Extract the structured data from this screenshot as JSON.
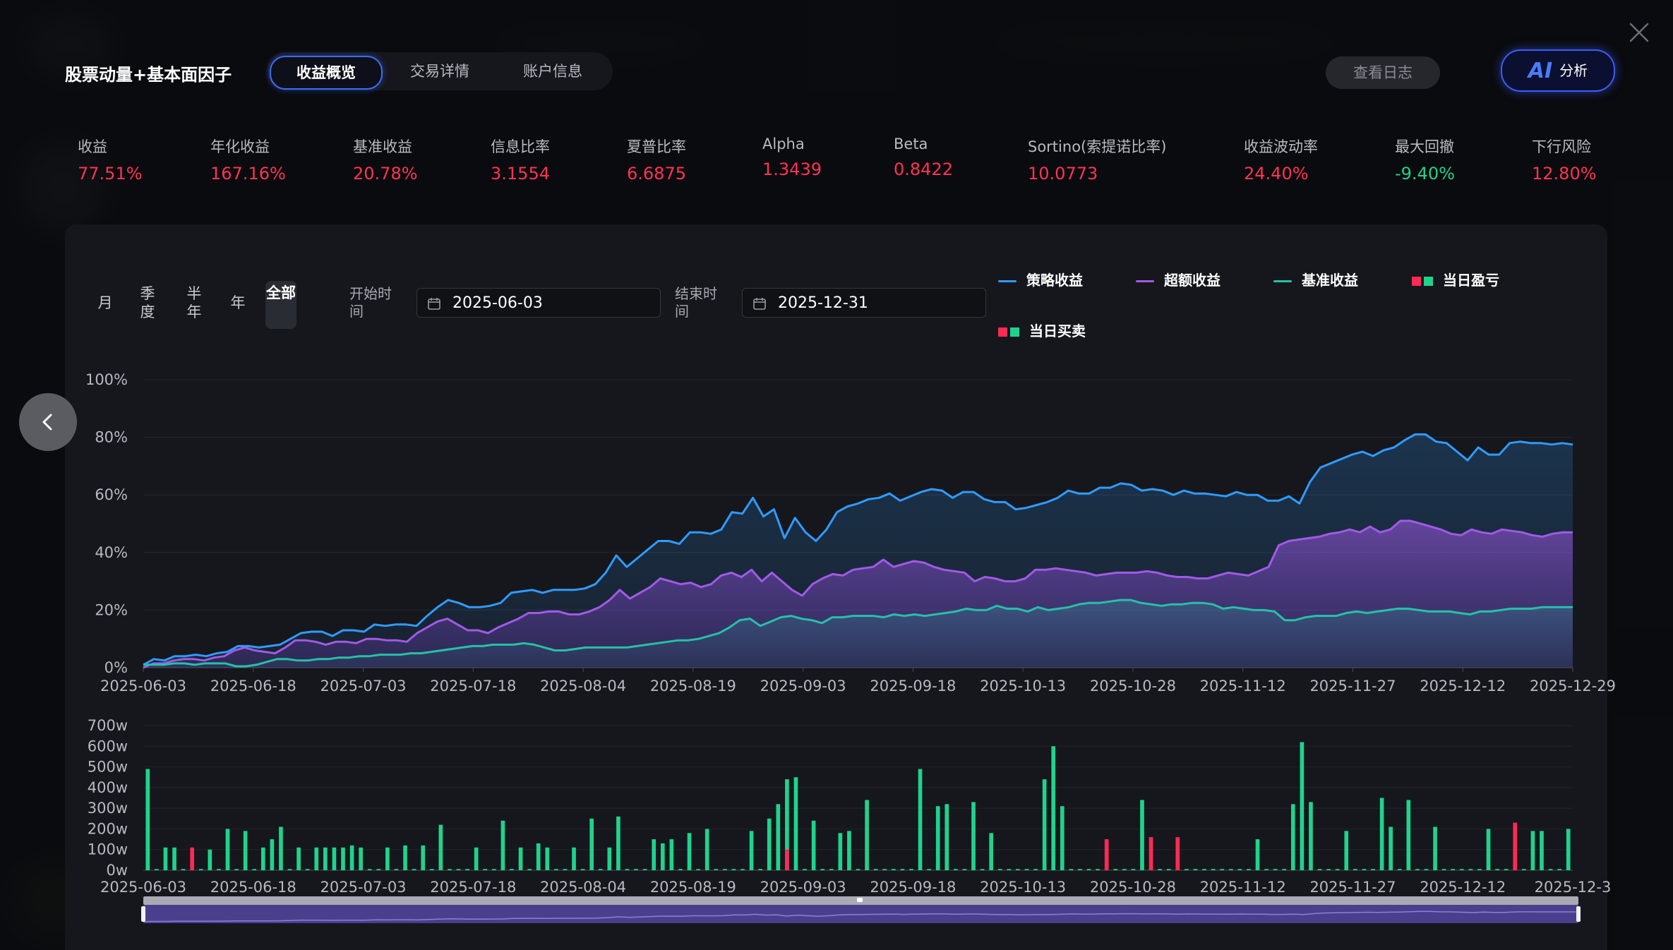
{
  "header": {
    "strategy_name": "股票动量+基本面因子",
    "tabs": [
      {
        "label": "收益概览",
        "active": true
      },
      {
        "label": "交易详情",
        "active": false
      },
      {
        "label": "账户信息",
        "active": false
      }
    ],
    "log_button": "查看日志",
    "ai_button_mark": "AI",
    "ai_button_label": "分析"
  },
  "metrics": [
    {
      "label": "收益",
      "value": "77.51%",
      "tone": "red"
    },
    {
      "label": "年化收益",
      "value": "167.16%",
      "tone": "red"
    },
    {
      "label": "基准收益",
      "value": "20.78%",
      "tone": "red"
    },
    {
      "label": "信息比率",
      "value": "3.1554",
      "tone": "red"
    },
    {
      "label": "夏普比率",
      "value": "6.6875",
      "tone": "red"
    },
    {
      "label": "Alpha",
      "value": "1.3439",
      "tone": "red"
    },
    {
      "label": "Beta",
      "value": "0.8422",
      "tone": "red"
    },
    {
      "label": "Sortino(索提诺比率)",
      "value": "10.0773",
      "tone": "red"
    },
    {
      "label": "收益波动率",
      "value": "24.40%",
      "tone": "red"
    },
    {
      "label": "最大回撤",
      "value": "-9.40%",
      "tone": "green"
    },
    {
      "label": "下行风险",
      "value": "12.80%",
      "tone": "red"
    }
  ],
  "controls": {
    "periods": [
      {
        "label": "月",
        "active": false
      },
      {
        "label": "季度",
        "active": false
      },
      {
        "label": "半年",
        "active": false
      },
      {
        "label": "年",
        "active": false
      },
      {
        "label": "全部",
        "active": true
      }
    ],
    "start_label": "开始时间",
    "start_value": "2025-06-03",
    "end_label": "结束时间",
    "end_value": "2025-12-31"
  },
  "legend": [
    {
      "label": "策略收益",
      "kind": "line",
      "color": "#2f9bff"
    },
    {
      "label": "超额收益",
      "kind": "line",
      "color": "#a259e8"
    },
    {
      "label": "基准收益",
      "kind": "line",
      "color": "#25c1a8"
    },
    {
      "label": "当日盈亏",
      "kind": "squares",
      "colors": [
        "#ff2a55",
        "#1fd38d"
      ]
    },
    {
      "label": "当日买卖",
      "kind": "squares",
      "colors": [
        "#ff2a55",
        "#1fd38d"
      ]
    }
  ],
  "colors": {
    "strategy": "#2f9bff",
    "excess": "#a259e8",
    "benchmark": "#25c1a8",
    "loss": "#ff2a55",
    "gain": "#1fd38d",
    "accent": "#3d6cff"
  },
  "chart_data": {
    "type": "line",
    "x_tick_labels": [
      "2025-06-03",
      "2025-06-18",
      "2025-07-03",
      "2025-07-18",
      "2025-08-04",
      "2025-08-19",
      "2025-09-03",
      "2025-09-18",
      "2025-10-13",
      "2025-10-28",
      "2025-11-12",
      "2025-11-27",
      "2025-12-12",
      "2025-12-29"
    ],
    "y_ticks": [
      "0%",
      "20%",
      "40%",
      "60%",
      "80%",
      "100%"
    ],
    "ylim": [
      0,
      100
    ],
    "grid": true,
    "legend_position": "top-right",
    "series": [
      {
        "name": "策略收益",
        "values": [
          1,
          3,
          2.5,
          4,
          4,
          4.5,
          4,
          5,
          5.5,
          7.5,
          7.5,
          7,
          7.5,
          8,
          10,
          12,
          12.5,
          12.5,
          11,
          13,
          13,
          12.5,
          15,
          14.5,
          15,
          15,
          14.5,
          18,
          21,
          23.5,
          22.5,
          21,
          21,
          21.5,
          22.5,
          26,
          26.5,
          27,
          26,
          27,
          27,
          27,
          27.5,
          29,
          33,
          39,
          35,
          38,
          41,
          44,
          44,
          43,
          47,
          47,
          46.5,
          48,
          54,
          53.5,
          59,
          52.5,
          55,
          45,
          52,
          47,
          44,
          48,
          54,
          56,
          57,
          58.5,
          59,
          60.5,
          58,
          59.5,
          61,
          62,
          61.5,
          59,
          61,
          61,
          58.5,
          57.5,
          57.5,
          55,
          55.5,
          56.5,
          57.5,
          59,
          61.5,
          60.5,
          60.5,
          62.5,
          62.5,
          64,
          63.5,
          61.5,
          62,
          61.5,
          60,
          61.5,
          60.5,
          60.5,
          60,
          59.5,
          61,
          60,
          60,
          58,
          58,
          59.5,
          57,
          64.5,
          69.5,
          71,
          72.5,
          74,
          75,
          73.5,
          75.5,
          76.5,
          79,
          81,
          81,
          78.5,
          78,
          75,
          72,
          76.5,
          74,
          74,
          78,
          78.5,
          78,
          78,
          77.5,
          78,
          77.5
        ],
        "color": "#2f9bff"
      },
      {
        "name": "超额收益",
        "values": [
          0,
          1.5,
          1.5,
          2.5,
          3,
          3,
          2.5,
          3.5,
          4,
          6,
          7,
          6,
          5.5,
          5,
          7,
          9.5,
          9.5,
          9,
          8,
          9,
          9,
          8.5,
          10,
          10,
          9.5,
          9.5,
          9,
          12,
          14,
          16,
          17,
          15,
          13,
          13,
          12,
          14,
          15.5,
          17,
          19,
          19,
          19.5,
          19.5,
          18.5,
          18.5,
          19.5,
          21,
          23.5,
          27,
          24,
          26,
          28,
          31,
          30,
          29,
          29.5,
          28,
          29,
          32,
          33,
          31.5,
          34,
          30,
          33,
          30,
          27,
          25,
          29,
          31,
          32.5,
          32,
          34,
          34.5,
          35,
          37.5,
          35,
          36,
          37,
          36.5,
          35,
          34,
          33.5,
          33,
          30,
          31.5,
          31,
          30,
          30,
          31,
          34,
          34,
          34.5,
          34,
          33.5,
          33,
          32,
          32.5,
          33,
          33,
          33,
          33.5,
          33,
          32,
          31.5,
          31.5,
          31,
          31,
          32,
          33,
          32.5,
          32,
          33.5,
          35,
          42.5,
          44,
          44.5,
          45,
          45.5,
          46.5,
          47,
          48,
          47,
          49,
          47,
          48,
          51,
          51,
          50,
          49,
          48,
          46.5,
          46,
          48,
          47,
          46.5,
          48,
          47.5,
          47,
          46,
          45.5,
          46.5,
          47,
          47
        ],
        "color": "#a259e8"
      },
      {
        "name": "基准收益",
        "values": [
          1,
          1,
          1,
          1.5,
          1.5,
          1,
          1.5,
          1.5,
          1.5,
          0.5,
          0.5,
          1,
          2,
          3,
          3,
          2.5,
          2.5,
          3,
          3,
          3.5,
          3.5,
          4,
          4,
          4.5,
          4.5,
          4.5,
          5,
          5,
          5.5,
          6,
          6.5,
          7,
          7.5,
          7.5,
          8,
          8,
          8,
          8.5,
          8,
          7,
          6,
          6,
          6.5,
          7,
          7,
          7,
          7,
          7,
          7.5,
          8,
          8.5,
          9,
          9.5,
          9.5,
          10,
          11,
          12,
          14,
          16.5,
          17,
          14.5,
          16,
          17.5,
          18,
          17,
          16.5,
          15.5,
          17.5,
          17.5,
          18,
          18,
          18,
          17.5,
          18.5,
          18,
          18.5,
          18,
          18.5,
          19,
          19.5,
          20.5,
          20,
          20,
          21.5,
          20.5,
          20.5,
          19.5,
          21,
          20,
          20.5,
          21,
          22,
          22.5,
          22.5,
          23,
          23.5,
          23.5,
          22.5,
          22,
          21.5,
          22,
          22,
          22.5,
          22.5,
          22,
          20.5,
          21,
          20.5,
          20,
          20,
          19.5,
          16.5,
          16.5,
          17.5,
          18,
          18,
          18,
          19,
          19.5,
          19,
          19.5,
          20,
          20.5,
          20.5,
          20,
          19.5,
          19.5,
          19.5,
          19,
          18.5,
          19.5,
          19.5,
          20,
          20.5,
          20.5,
          20.5,
          21,
          21,
          21,
          21
        ],
        "color": "#25c1a8"
      }
    ],
    "volume": {
      "y_ticks": [
        "0w",
        "100w",
        "200w",
        "300w",
        "400w",
        "500w",
        "600w",
        "700w"
      ],
      "x_tick_labels": [
        "2025-06-03",
        "2025-06-18",
        "2025-07-03",
        "2025-07-18",
        "2025-08-04",
        "2025-08-19",
        "2025-09-03",
        "2025-09-18",
        "2025-10-13",
        "2025-10-28",
        "2025-11-12",
        "2025-11-27",
        "2025-12-12",
        "2025-12-3"
      ],
      "buy_values": [
        490,
        0,
        110,
        110,
        0,
        0,
        0,
        100,
        0,
        200,
        0,
        190,
        0,
        110,
        150,
        210,
        0,
        110,
        0,
        110,
        110,
        110,
        110,
        120,
        110,
        0,
        0,
        110,
        0,
        120,
        0,
        120,
        0,
        220,
        0,
        0,
        0,
        110,
        0,
        0,
        240,
        0,
        110,
        0,
        130,
        110,
        0,
        0,
        110,
        0,
        250,
        0,
        110,
        260,
        0,
        0,
        0,
        150,
        130,
        150,
        0,
        180,
        0,
        200,
        0,
        0,
        0,
        0,
        190,
        0,
        250,
        320,
        440,
        450,
        0,
        240,
        0,
        0,
        180,
        190,
        0,
        340,
        0,
        0,
        0,
        0,
        0,
        490,
        0,
        310,
        320,
        0,
        0,
        330,
        0,
        180,
        0,
        0,
        0,
        0,
        0,
        440,
        600,
        310,
        0,
        0,
        0,
        0,
        0,
        0,
        0,
        0,
        340,
        0,
        0,
        0,
        0,
        0,
        0,
        0,
        0,
        0,
        0,
        0,
        0,
        150,
        0,
        0,
        0,
        320,
        620,
        330,
        0,
        0,
        0,
        190,
        0,
        0,
        0,
        350,
        210,
        0,
        340,
        0,
        0,
        210,
        0,
        0,
        0,
        0,
        0,
        200,
        0,
        0,
        0,
        0,
        190,
        190,
        0,
        0,
        200
      ],
      "sell_values": [
        0,
        0,
        0,
        0,
        0,
        110,
        0,
        0,
        0,
        0,
        0,
        0,
        0,
        0,
        0,
        0,
        0,
        0,
        0,
        0,
        0,
        0,
        0,
        0,
        0,
        0,
        0,
        0,
        0,
        0,
        0,
        0,
        0,
        0,
        0,
        0,
        0,
        0,
        0,
        0,
        0,
        0,
        0,
        0,
        0,
        0,
        0,
        0,
        0,
        0,
        0,
        0,
        0,
        0,
        0,
        0,
        0,
        0,
        0,
        0,
        0,
        0,
        0,
        0,
        0,
        0,
        0,
        0,
        0,
        0,
        0,
        0,
        100,
        0,
        0,
        0,
        0,
        0,
        0,
        0,
        0,
        0,
        0,
        0,
        0,
        0,
        0,
        0,
        0,
        0,
        0,
        0,
        0,
        0,
        0,
        0,
        0,
        0,
        0,
        0,
        0,
        0,
        0,
        0,
        0,
        0,
        0,
        0,
        150,
        0,
        0,
        0,
        0,
        160,
        0,
        0,
        160,
        0,
        0,
        0,
        0,
        0,
        0,
        0,
        0,
        0,
        0,
        0,
        0,
        0,
        0,
        0,
        0,
        0,
        0,
        0,
        0,
        0,
        0,
        0,
        0,
        0,
        0,
        0,
        0,
        0,
        0,
        0,
        0,
        0,
        0,
        0,
        0,
        0,
        230,
        0,
        0,
        0,
        0,
        0,
        0,
        0,
        0,
        0
      ]
    }
  }
}
